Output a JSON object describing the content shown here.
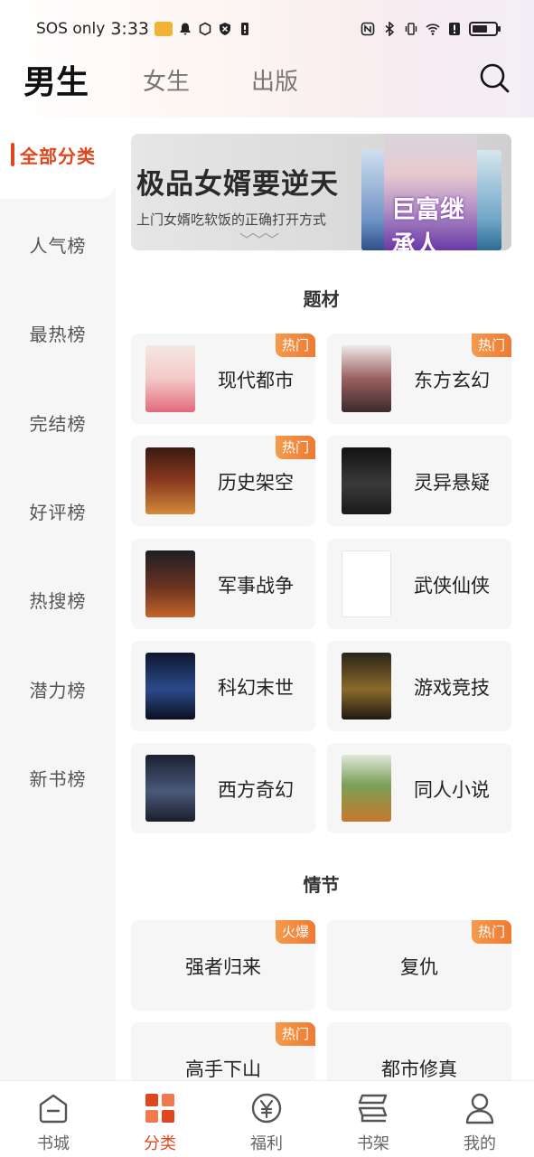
{
  "status_bar": {
    "carrier": "SOS only",
    "time": "3:33"
  },
  "top_tabs": {
    "male": "男生",
    "female": "女生",
    "publish": "出版"
  },
  "sidebar": {
    "items": [
      {
        "label": "全部分类",
        "active": true
      },
      {
        "label": "人气榜"
      },
      {
        "label": "最热榜"
      },
      {
        "label": "完结榜"
      },
      {
        "label": "好评榜"
      },
      {
        "label": "热搜榜"
      },
      {
        "label": "潜力榜"
      },
      {
        "label": "新书榜"
      }
    ]
  },
  "banner": {
    "title": "极品女婿要逆天",
    "subtitle": "上门女婿吃软饭的正确打开方式",
    "cover_text": "巨富继承人"
  },
  "sections": {
    "theme_title": "题材",
    "plot_title": "情节"
  },
  "theme_cards": [
    {
      "label": "现代都市",
      "badge": "热门"
    },
    {
      "label": "东方玄幻",
      "badge": "热门"
    },
    {
      "label": "历史架空",
      "badge": "热门"
    },
    {
      "label": "灵异悬疑",
      "badge": ""
    },
    {
      "label": "军事战争",
      "badge": ""
    },
    {
      "label": "武侠仙侠",
      "badge": ""
    },
    {
      "label": "科幻末世",
      "badge": ""
    },
    {
      "label": "游戏竞技",
      "badge": ""
    },
    {
      "label": "西方奇幻",
      "badge": ""
    },
    {
      "label": "同人小说",
      "badge": ""
    }
  ],
  "plot_cards": [
    {
      "label": "强者归来",
      "badge": "火爆"
    },
    {
      "label": "复仇",
      "badge": "热门"
    },
    {
      "label": "高手下山",
      "badge": "热门"
    },
    {
      "label": "都市修真",
      "badge": ""
    }
  ],
  "bottom_nav": {
    "items": [
      {
        "label": "书城",
        "icon": "home-icon"
      },
      {
        "label": "分类",
        "icon": "category-icon",
        "active": true
      },
      {
        "label": "福利",
        "icon": "yen-icon"
      },
      {
        "label": "书架",
        "icon": "bookshelf-icon"
      },
      {
        "label": "我的",
        "icon": "profile-icon"
      }
    ]
  },
  "colors": {
    "accent": "#e1471e",
    "badge": "#ee7a32",
    "sidebar_bg": "#f6f6f6",
    "card_bg": "#f6f6f6"
  }
}
